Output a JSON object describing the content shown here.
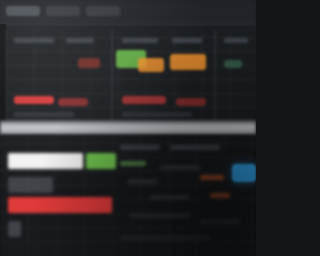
{
  "window": {
    "title": ""
  },
  "tabs": [
    "",
    "",
    ""
  ],
  "colors": {
    "background": "#121417",
    "panel": "#1a1d20",
    "separator": "#c9ccd0",
    "green": "#6cc04a",
    "orange": "#f2922c",
    "red": "#e03a3a",
    "white": "#f2f2f2",
    "blue": "#2f9de0",
    "gray": "#5a5f66"
  },
  "summary_bars": [
    {
      "color": "white",
      "value": 0.75
    },
    {
      "color": "green",
      "value": 0.3
    },
    {
      "color": "gray",
      "value": 0.45
    },
    {
      "color": "red",
      "value": 0.8
    },
    {
      "color": "gray",
      "value": 0.1
    }
  ],
  "toggle": {
    "state": "on"
  }
}
